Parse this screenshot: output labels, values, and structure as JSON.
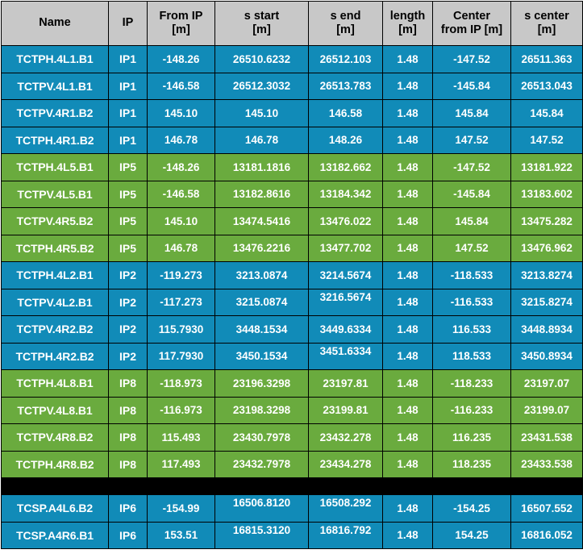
{
  "table": {
    "columns": [
      {
        "title": "Name",
        "unit": ""
      },
      {
        "title": "IP",
        "unit": ""
      },
      {
        "title": "From IP",
        "unit": "[m]"
      },
      {
        "title": "s start",
        "unit": "[m]"
      },
      {
        "title": "s end",
        "unit": "[m]"
      },
      {
        "title": "length",
        "unit": "[m]"
      },
      {
        "title": "Center",
        "unit": "from IP [m]"
      },
      {
        "title": "s center",
        "unit": "[m]"
      }
    ],
    "colors": {
      "header_bg": "#c8c8c8",
      "blue_row": "#118bb8",
      "green_row": "#6aab3e",
      "separator": "#000000",
      "grid": "#000000",
      "row_text": "#ffffff",
      "header_text": "#000000"
    },
    "rows": [
      {
        "group": "blue",
        "name": "TCTPH.4L1.B1",
        "ip": "IP1",
        "from_ip": "-148.26",
        "s_start": "26510.6232",
        "s_end": "26512.103",
        "length": "1.48",
        "center_from_ip": "-147.52",
        "s_center": "26511.363"
      },
      {
        "group": "blue",
        "name": "TCTPV.4L1.B1",
        "ip": "IP1",
        "from_ip": "-146.58",
        "s_start": "26512.3032",
        "s_end": "26513.783",
        "length": "1.48",
        "center_from_ip": "-145.84",
        "s_center": "26513.043"
      },
      {
        "group": "blue",
        "name": "TCTPV.4R1.B2",
        "ip": "IP1",
        "from_ip": "145.10",
        "s_start": "145.10",
        "s_end": "146.58",
        "length": "1.48",
        "center_from_ip": "145.84",
        "s_center": "145.84"
      },
      {
        "group": "blue",
        "name": "TCTPH.4R1.B2",
        "ip": "IP1",
        "from_ip": "146.78",
        "s_start": "146.78",
        "s_end": "148.26",
        "length": "1.48",
        "center_from_ip": "147.52",
        "s_center": "147.52"
      },
      {
        "group": "green",
        "name": "TCTPH.4L5.B1",
        "ip": "IP5",
        "from_ip": "-148.26",
        "s_start": "13181.1816",
        "s_end": "13182.662",
        "length": "1.48",
        "center_from_ip": "-147.52",
        "s_center": "13181.922"
      },
      {
        "group": "green",
        "name": "TCTPV.4L5.B1",
        "ip": "IP5",
        "from_ip": "-146.58",
        "s_start": "13182.8616",
        "s_end": "13184.342",
        "length": "1.48",
        "center_from_ip": "-145.84",
        "s_center": "13183.602"
      },
      {
        "group": "green",
        "name": "TCTPV.4R5.B2",
        "ip": "IP5",
        "from_ip": "145.10",
        "s_start": "13474.5416",
        "s_end": "13476.022",
        "length": "1.48",
        "center_from_ip": "145.84",
        "s_center": "13475.282"
      },
      {
        "group": "green",
        "name": "TCTPH.4R5.B2",
        "ip": "IP5",
        "from_ip": "146.78",
        "s_start": "13476.2216",
        "s_end": "13477.702",
        "length": "1.48",
        "center_from_ip": "147.52",
        "s_center": "13476.962"
      },
      {
        "group": "blue",
        "name": "TCTPH.4L2.B1",
        "ip": "IP2",
        "from_ip": "-119.273",
        "s_start": "3213.0874",
        "s_end": "3214.5674",
        "length": "1.48",
        "center_from_ip": "-118.533",
        "s_center": "3213.8274"
      },
      {
        "group": "blue",
        "name": "TCTPV.4L2.B1",
        "ip": "IP2",
        "from_ip": "-117.273",
        "s_start": "3215.0874",
        "s_end": "3216.5674",
        "length": "1.48",
        "center_from_ip": "-116.533",
        "s_center": "3215.8274",
        "send_shift": true
      },
      {
        "group": "blue",
        "name": "TCTPV.4R2.B2",
        "ip": "IP2",
        "from_ip": "115.7930",
        "s_start": "3448.1534",
        "s_end": "3449.6334",
        "length": "1.48",
        "center_from_ip": "116.533",
        "s_center": "3448.8934"
      },
      {
        "group": "blue",
        "name": "TCTPH.4R2.B2",
        "ip": "IP2",
        "from_ip": "117.7930",
        "s_start": "3450.1534",
        "s_end": "3451.6334",
        "length": "1.48",
        "center_from_ip": "118.533",
        "s_center": "3450.8934",
        "send_shift": true
      },
      {
        "group": "green",
        "name": "TCTPH.4L8.B1",
        "ip": "IP8",
        "from_ip": "-118.973",
        "s_start": "23196.3298",
        "s_end": "23197.81",
        "length": "1.48",
        "center_from_ip": "-118.233",
        "s_center": "23197.07"
      },
      {
        "group": "green",
        "name": "TCTPV.4L8.B1",
        "ip": "IP8",
        "from_ip": "-116.973",
        "s_start": "23198.3298",
        "s_end": "23199.81",
        "length": "1.48",
        "center_from_ip": "-116.233",
        "s_center": "23199.07"
      },
      {
        "group": "green",
        "name": "TCTPV.4R8.B2",
        "ip": "IP8",
        "from_ip": "115.493",
        "s_start": "23430.7978",
        "s_end": "23432.278",
        "length": "1.48",
        "center_from_ip": "116.235",
        "s_center": "23431.538"
      },
      {
        "group": "green",
        "name": "TCTPH.4R8.B2",
        "ip": "IP8",
        "from_ip": "117.493",
        "s_start": "23432.7978",
        "s_end": "23434.278",
        "length": "1.48",
        "center_from_ip": "118.235",
        "s_center": "23433.538"
      },
      {
        "separator": true
      },
      {
        "group": "blue",
        "name": "TCSP.A4L6.B2",
        "ip": "IP6",
        "from_ip": "-154.99",
        "s_start": "16506.8120",
        "s_end": "16508.292",
        "length": "1.48",
        "center_from_ip": "-154.25",
        "s_center": "16507.552",
        "sstart_shift": true,
        "send_shift": true
      },
      {
        "group": "blue",
        "name": "TCSP.A4R6.B1",
        "ip": "IP6",
        "from_ip": "153.51",
        "s_start": "16815.3120",
        "s_end": "16816.792",
        "length": "1.48",
        "center_from_ip": "154.25",
        "s_center": "16816.052",
        "sstart_shift": true,
        "send_shift": true
      }
    ]
  }
}
